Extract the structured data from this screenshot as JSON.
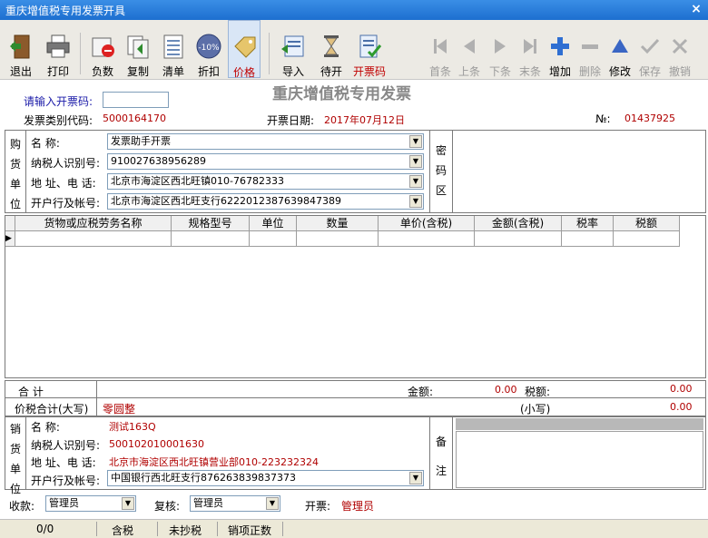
{
  "window": {
    "title": "重庆增值税专用发票开具",
    "close_glyph": "×"
  },
  "toolbar": {
    "exit": "退出",
    "print": "打印",
    "negative": "负数",
    "copy": "复制",
    "list": "清单",
    "discount": "折扣",
    "discount_badge": "-10%",
    "price": "价格",
    "import": "导入",
    "pending": "待开",
    "issue": "开票码",
    "first": "首条",
    "prev": "上条",
    "next": "下条",
    "last": "末条",
    "add": "增加",
    "delete": "删除",
    "modify": "修改",
    "save": "保存",
    "cancel": "撤销"
  },
  "invoice": {
    "title": "重庆增值税专用发票",
    "input_code_label": "请输入开票码:",
    "input_code_value": "",
    "type_code_label": "发票类别代码:",
    "type_code_value": "5000164170",
    "date_label": "开票日期:",
    "date_value": "2017年07月12日",
    "no_label": "№:",
    "no_value": "01437925"
  },
  "buyer": {
    "side_label": [
      "购",
      "货",
      "单",
      "位"
    ],
    "name_label": "名        称:",
    "name_value": "发票助手开票",
    "tax_id_label": "纳税人识别号:",
    "tax_id_value": "910027638956289",
    "address_label": "地 址、电 话:",
    "address_value": "北京市海淀区西北旺镇010-76782333",
    "bank_label": "开户行及帐号:",
    "bank_value": "北京市海淀区西北旺支行6222012387639847389",
    "cipher_label": [
      "密",
      "码",
      "区"
    ]
  },
  "grid": {
    "headers": [
      "货物或应税劳务名称",
      "规格型号",
      "单位",
      "数量",
      "单价(含税)",
      "金额(含税)",
      "税率",
      "税额"
    ]
  },
  "totals": {
    "sum_label": "合        计",
    "amount_label": "金额:",
    "amount_value": "0.00",
    "tax_label": "税额:",
    "tax_value": "0.00",
    "total_label": "价税合计(大写)",
    "total_upper": "零圆整",
    "small_label": "(小写)",
    "small_value": "0.00"
  },
  "seller": {
    "side_label": [
      "销",
      "货",
      "单",
      "位"
    ],
    "name_label": "名        称:",
    "name_value": "测试163Q",
    "tax_id_label": "纳税人识别号:",
    "tax_id_value": "500102010001630",
    "address_label": "地 址、电 话:",
    "address_value": "北京市海淀区西北旺镇营业部010-223232324",
    "bank_label": "开户行及帐号:",
    "bank_value": "中国银行西北旺支行876263839837373",
    "remark_label": [
      "备",
      "注"
    ]
  },
  "signers": {
    "payee_label": "收款:",
    "payee_value": "管理员",
    "reviewer_label": "复核:",
    "reviewer_value": "管理员",
    "drawer_label": "开票:",
    "drawer_value": "管理员"
  },
  "status": {
    "count": "0/0",
    "tax_mode": "含税",
    "copied": "未抄税",
    "line_mode": "销项正数"
  },
  "colors": {
    "title_bar": "#1d6fd0",
    "accent_red": "#b00000",
    "label_blue": "#1a1aa8"
  }
}
